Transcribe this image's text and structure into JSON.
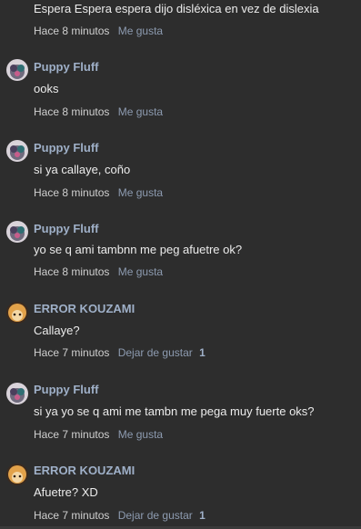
{
  "comments": [
    {
      "author": "",
      "text": "Espera Espera espera dijo disléxica en vez de dislexia",
      "time": "Hace 8 minutos",
      "action": "Me gusta",
      "count": ""
    },
    {
      "author": "Puppy Fluff",
      "text": "ooks",
      "time": "Hace 8 minutos",
      "action": "Me gusta",
      "count": ""
    },
    {
      "author": "Puppy Fluff",
      "text": "si ya callaye, coño",
      "time": "Hace 8 minutos",
      "action": "Me gusta",
      "count": ""
    },
    {
      "author": "Puppy Fluff",
      "text": "yo se q ami tambnn me peg afuetre ok?",
      "time": "Hace 8 minutos",
      "action": "Me gusta",
      "count": ""
    },
    {
      "author": "ERROR KOUZAMI",
      "text": "Callaye?",
      "time": "Hace 7 minutos",
      "action": "Dejar de gustar",
      "count": "1"
    },
    {
      "author": "Puppy Fluff",
      "text": "si ya yo se q ami me tambn me pega muy fuerte oks?",
      "time": "Hace 7 minutos",
      "action": "Me gusta",
      "count": ""
    },
    {
      "author": "ERROR KOUZAMI",
      "text": "Afuetre? XD",
      "time": "Hace 7 minutos",
      "action": "Dejar de gustar",
      "count": "1"
    }
  ],
  "colors": {
    "background": "#2d2d2d",
    "author": "#9fb0c8",
    "action": "#8d9bb0"
  }
}
